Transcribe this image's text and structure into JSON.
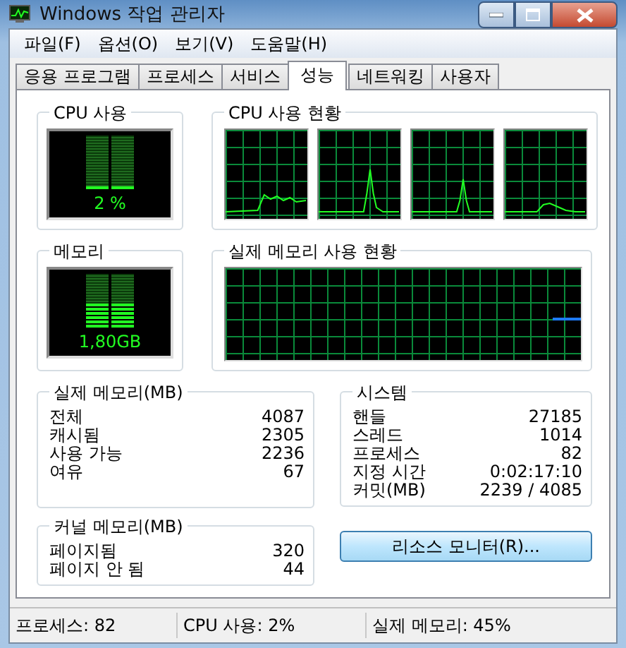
{
  "window": {
    "title": "Windows 작업 관리자"
  },
  "menu": [
    "파일(F)",
    "옵션(O)",
    "보기(V)",
    "도움말(H)"
  ],
  "tabs": [
    {
      "label": "응용 프로그램",
      "selected": false
    },
    {
      "label": "프로세스",
      "selected": false
    },
    {
      "label": "서비스",
      "selected": false
    },
    {
      "label": "성능",
      "selected": true
    },
    {
      "label": "네트워킹",
      "selected": false
    },
    {
      "label": "사용자",
      "selected": false
    }
  ],
  "cpu_usage": {
    "title": "CPU 사용",
    "level": 0.02,
    "reading": "2 %"
  },
  "cpu_history": {
    "title": "CPU 사용 현황"
  },
  "memory": {
    "title": "메모리",
    "level": 0.45,
    "reading": "1,80GB"
  },
  "memory_history": {
    "title": "실제 메모리 사용 현황"
  },
  "physical_memory": {
    "title": "실제 메모리(MB)",
    "rows": [
      {
        "label": "전체",
        "value": "4087"
      },
      {
        "label": "캐시됨",
        "value": "2305"
      },
      {
        "label": "사용 가능",
        "value": "2236"
      },
      {
        "label": "여유",
        "value": "67"
      }
    ]
  },
  "system": {
    "title": "시스템",
    "rows": [
      {
        "label": "핸들",
        "value": "27185"
      },
      {
        "label": "스레드",
        "value": "1014"
      },
      {
        "label": "프로세스",
        "value": "82"
      },
      {
        "label": "지정 시간",
        "value": "0:02:17:10"
      },
      {
        "label": "커밋(MB)",
        "value": "2239 / 4085"
      }
    ]
  },
  "kernel_memory": {
    "title": "커널 메모리(MB)",
    "rows": [
      {
        "label": "페이지됨",
        "value": "320"
      },
      {
        "label": "페이지 안 됨",
        "value": "44"
      }
    ]
  },
  "resource_monitor_button": "리소스 모니터(R)...",
  "status_bar": [
    "프로세스: 82",
    "CPU 사용: 2%",
    "실제 메모리: 45%"
  ]
}
